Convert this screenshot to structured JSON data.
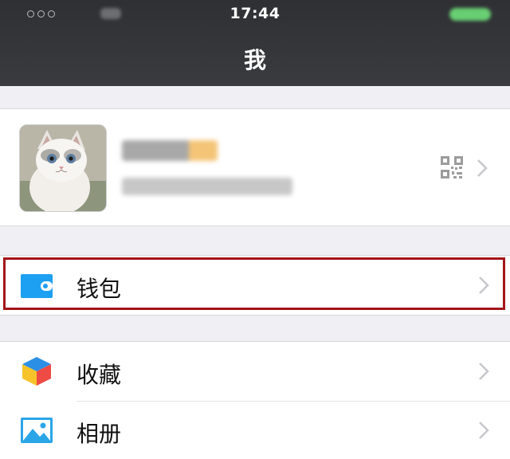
{
  "status_bar": {
    "time": "17:44"
  },
  "nav": {
    "title": "我"
  },
  "profile": {
    "avatar": "cat-photo"
  },
  "menu": {
    "wallet_label": "钱包",
    "favorites_label": "收藏",
    "album_label": "相册"
  },
  "colors": {
    "nav_bg": "#35363a",
    "page_bg": "#efeff4",
    "wallet_icon": "#1ea0f2",
    "album_icon": "#2aa5e8",
    "highlight": "#a31518"
  },
  "icons": {
    "wallet": "wallet-icon",
    "favorites": "cube-icon",
    "album": "image-icon",
    "qr": "qr-code-icon",
    "chevron": "chevron-right-icon"
  }
}
